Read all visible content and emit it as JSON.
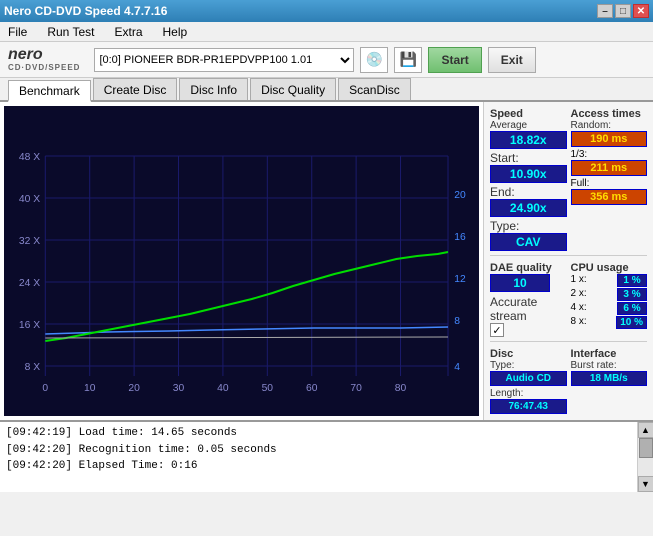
{
  "titlebar": {
    "title": "Nero CD-DVD Speed 4.7.7.16",
    "min_label": "–",
    "max_label": "□",
    "close_label": "✕"
  },
  "menu": {
    "items": [
      "File",
      "Run Test",
      "Extra",
      "Help"
    ]
  },
  "toolbar": {
    "logo_nero": "nero",
    "logo_sub": "CD·DVD/SPEED",
    "drive_value": "[0:0]  PIONEER BDR-PR1EPDVPP100 1.01",
    "start_label": "Start",
    "exit_label": "Exit"
  },
  "tabs": [
    {
      "label": "Benchmark",
      "active": true
    },
    {
      "label": "Create Disc",
      "active": false
    },
    {
      "label": "Disc Info",
      "active": false
    },
    {
      "label": "Disc Quality",
      "active": false
    },
    {
      "label": "ScanDisc",
      "active": false
    }
  ],
  "chart": {
    "x_labels": [
      "0",
      "10",
      "20",
      "30",
      "40",
      "50",
      "60",
      "70",
      "80"
    ],
    "y_labels_left": [
      "8 X",
      "16 X",
      "24 X",
      "32 X",
      "40 X",
      "48 X"
    ],
    "y_labels_right": [
      "4",
      "8",
      "12",
      "16",
      "20"
    ]
  },
  "stats": {
    "speed_header": "Speed",
    "average_label": "Average",
    "average_value": "18.82x",
    "start_label": "Start:",
    "start_value": "10.90x",
    "end_label": "End:",
    "end_value": "24.90x",
    "type_label": "Type:",
    "type_value": "CAV",
    "dae_header": "DAE quality",
    "dae_value": "10",
    "accurate_stream_label": "Accurate stream",
    "access_header": "Access times",
    "random_label": "Random:",
    "random_value": "190 ms",
    "one_third_label": "1/3:",
    "one_third_value": "211 ms",
    "full_label": "Full:",
    "full_value": "356 ms",
    "cpu_header": "CPU usage",
    "cpu_1x_label": "1 x:",
    "cpu_1x_value": "1 %",
    "cpu_2x_label": "2 x:",
    "cpu_2x_value": "3 %",
    "cpu_4x_label": "4 x:",
    "cpu_4x_value": "6 %",
    "cpu_8x_label": "8 x:",
    "cpu_8x_value": "10 %",
    "disc_header": "Disc",
    "disc_type_label": "Type:",
    "disc_type_value": "Audio CD",
    "disc_length_label": "Length:",
    "disc_length_value": "76:47.43",
    "interface_header": "Interface",
    "burst_label": "Burst rate:",
    "burst_value": "18 MB/s"
  },
  "log": {
    "lines": [
      "[09:42:19]  Load time: 14.65 seconds",
      "[09:42:20]  Recognition time: 0.05 seconds",
      "[09:42:20]  Elapsed Time: 0:16"
    ]
  }
}
